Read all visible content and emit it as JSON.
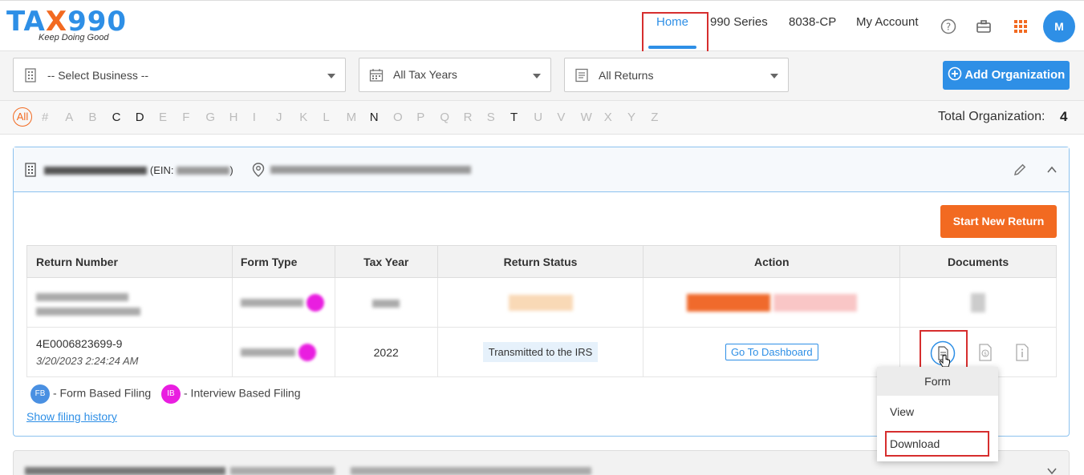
{
  "header": {
    "logo_main": "TAX990",
    "logo_tagline": "Keep Doing Good",
    "nav": {
      "home": "Home",
      "series990": "990 Series",
      "form8038": "8038-CP",
      "my_account": "My Account"
    },
    "avatar_initial": "M"
  },
  "filters": {
    "business": "-- Select Business --",
    "tax_years": "All Tax Years",
    "returns": "All Returns",
    "add_org": "Add Organization"
  },
  "alphabet": {
    "all": "All",
    "letters": [
      "#",
      "A",
      "B",
      "C",
      "D",
      "E",
      "F",
      "G",
      "H",
      "I",
      "J",
      "K",
      "L",
      "M",
      "N",
      "O",
      "P",
      "Q",
      "R",
      "S",
      "T",
      "U",
      "V",
      "W",
      "X",
      "Y",
      "Z"
    ],
    "active": [
      "C",
      "D",
      "N",
      "T"
    ],
    "total_label": "Total Organization:",
    "total_count": "4"
  },
  "org": {
    "ein_label": "(EIN:",
    "start_new_return": "Start New Return",
    "table": {
      "headers": [
        "Return Number",
        "Form Type",
        "Tax Year",
        "Return Status",
        "Action",
        "Documents"
      ],
      "row2": {
        "return_number": "4E0006823699-9",
        "timestamp": "3/20/2023 2:24:24 AM",
        "tax_year": "2022",
        "status": "Transmitted to the IRS",
        "action": "Go To Dashboard"
      }
    },
    "legend": {
      "fb_badge": "FB",
      "fb_label": "- Form Based Filing",
      "ib_badge": "IB",
      "ib_label": "- Interview Based Filing"
    },
    "history_link": "Show filing history"
  },
  "dropdown": {
    "header": "Form",
    "items": [
      "View",
      "Download"
    ]
  },
  "colors": {
    "brand_blue": "#2e8fe6",
    "brand_orange": "#f26a21",
    "highlight_red": "#d62e2e",
    "ib_magenta": "#e91ee0"
  }
}
